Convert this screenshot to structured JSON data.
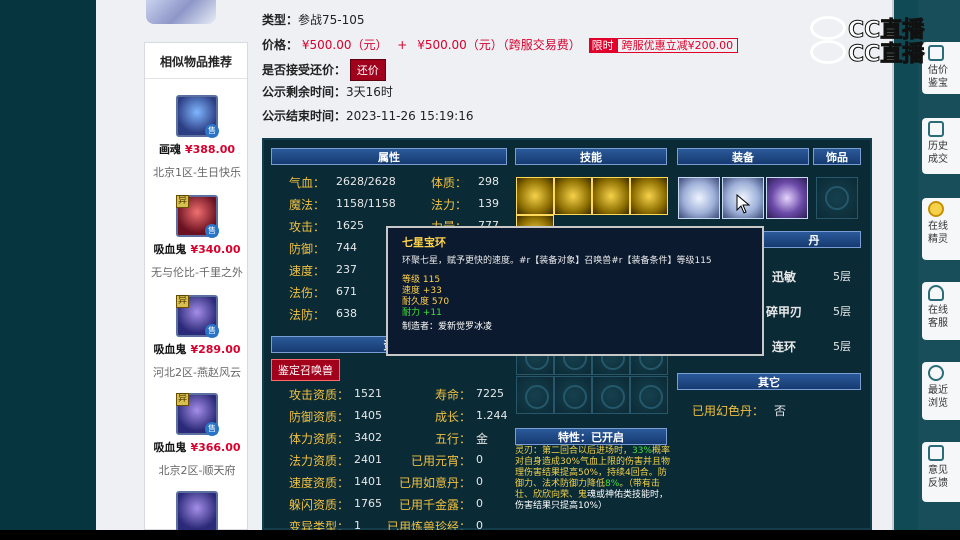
{
  "listing": {
    "type_label": "类型：",
    "type_value": "参战75-105",
    "price_label": "价格：",
    "price_value": "¥500.00（元）",
    "price_plus": "+",
    "price_cross": "¥500.00（元）（跨服交易费）",
    "limit_badge": "限时",
    "promo_text": "跨服优惠立减¥200.00",
    "counter_label": "是否接受还价：",
    "counter_button": "还价",
    "remain_label": "公示剩余时间：",
    "remain_value": "3天16时",
    "end_label": "公示结束时间：",
    "end_value": "2023-11-26  15:19:16"
  },
  "similar": {
    "title": "相似物品推荐",
    "sell_mark": "售",
    "yi_mark": "异",
    "items": [
      {
        "name": "画魂",
        "price": "¥388.00",
        "server": "北京1区-生日快乐"
      },
      {
        "name": "吸血鬼",
        "price": "¥340.00",
        "server": "无与伦比-千里之外"
      },
      {
        "name": "吸血鬼",
        "price": "¥289.00",
        "server": "河北2区-燕赵风云"
      },
      {
        "name": "吸血鬼",
        "price": "¥366.00",
        "server": "北京2区-顺天府"
      }
    ]
  },
  "panel": {
    "headers": {
      "attr": "属性",
      "skill": "技能",
      "equip": "装备",
      "jewel": "饰品",
      "other": "其它",
      "trait": "特性：已开启",
      "neidan": "丹",
      "zizhi": "资"
    },
    "attrs_left": [
      {
        "label": "气血：",
        "value": "2628/2628"
      },
      {
        "label": "魔法：",
        "value": "1158/1158"
      },
      {
        "label": "攻击：",
        "value": "1625"
      },
      {
        "label": "防御：",
        "value": "744"
      },
      {
        "label": "速度：",
        "value": "237"
      },
      {
        "label": "法伤：",
        "value": "671"
      },
      {
        "label": "法防：",
        "value": "638"
      }
    ],
    "attrs_right": [
      {
        "label": "体质：",
        "value": "298"
      },
      {
        "label": "法力：",
        "value": "139"
      },
      {
        "label": "力量：",
        "value": "777"
      }
    ],
    "appraise_button": "鉴定召唤兽",
    "zizhi_left": [
      {
        "label": "攻击资质：",
        "value": "1521"
      },
      {
        "label": "防御资质：",
        "value": "1405"
      },
      {
        "label": "体力资质：",
        "value": "3402"
      },
      {
        "label": "法力资质：",
        "value": "2401"
      },
      {
        "label": "速度资质：",
        "value": "1401"
      },
      {
        "label": "躲闪资质：",
        "value": "1765"
      },
      {
        "label": "变异类型：",
        "value": "1"
      }
    ],
    "zizhi_right": [
      {
        "label": "寿命：",
        "value": "7225"
      },
      {
        "label": "成长：",
        "value": "1.244"
      },
      {
        "label": "五行：",
        "value": "金"
      },
      {
        "label": "已用元宵：",
        "value": "0"
      },
      {
        "label": "已用如意丹：",
        "value": "0"
      },
      {
        "label": "已用千金露：",
        "value": "0"
      },
      {
        "label": "已用炼兽珍经：",
        "value": "0"
      }
    ],
    "neidan": [
      {
        "name": "迅敏",
        "level": "5层"
      },
      {
        "name": "碎甲刃",
        "level": "5层"
      },
      {
        "name": "连环",
        "level": "5层"
      }
    ],
    "other_label": "已用幻色丹：",
    "other_value": "否",
    "trait_lines": [
      {
        "text": "灵刃：第二回合以后进场时，",
        "cls": "y"
      },
      {
        "text": "33%",
        "cls": "g"
      },
      {
        "text": "概率对自身造成30%气血上限的伤",
        "cls": "y"
      },
      {
        "text": "害并且物理伤害结果提高50%，持",
        "cls": "y"
      },
      {
        "text": "续4回合。防御力、法术防御力降",
        "cls": "y"
      },
      {
        "text": "低",
        "cls": "y"
      },
      {
        "text": "8%",
        "cls": "g"
      },
      {
        "text": "。（带有击壮、欣欣向荣、鬼",
        "cls": "y"
      },
      {
        "text": "魂或神佑类技能时，伤害结果只提",
        "cls": "w"
      },
      {
        "text": "高10%）",
        "cls": "w"
      }
    ]
  },
  "tooltip": {
    "title": "七星宝环",
    "desc": "环聚七星，赋予更快的速度。#r【装备对象】召唤兽#r【装备条件】等级115",
    "stats": [
      "等级 115",
      "速度 +33",
      "耐久度 570"
    ],
    "green": "耐力 +11",
    "maker": "制造者：爱新觉罗冰凌"
  },
  "logo": {
    "line1": "CC直播",
    "line2": "CC直播"
  },
  "right_sidebar": [
    {
      "line1": "估价",
      "line2": "鉴宝"
    },
    {
      "line1": "历史",
      "line2": "成交"
    },
    {
      "line1": "在线",
      "line2": "精灵"
    },
    {
      "line1": "在线",
      "line2": "客服"
    },
    {
      "line1": "最近",
      "line2": "浏览"
    },
    {
      "line1": "意见",
      "line2": "反馈"
    }
  ]
}
